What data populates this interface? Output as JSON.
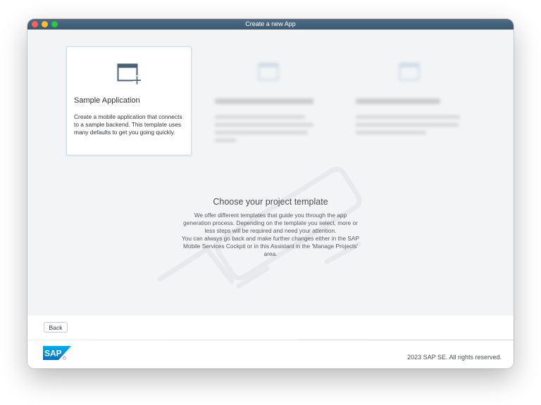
{
  "window": {
    "title": "Create a new App"
  },
  "templates": [
    {
      "title": "Sample Application",
      "description": "Create a mobile application that connects to a sample backend. This template uses many defaults to get you going quickly.",
      "selected": true,
      "icon": "new-window-icon"
    },
    {
      "title": "",
      "description": "",
      "selected": false,
      "icon": "new-window-icon"
    },
    {
      "title": "",
      "description": "",
      "selected": false,
      "icon": "new-window-icon"
    }
  ],
  "info": {
    "title": "Choose your project template",
    "text_lines": [
      "We offer different templates that guide you through the app",
      "generation process. Depending on the template you select, more or",
      "less steps will be required and need your attention.",
      "You can always go back and make further changes either in the SAP",
      "Mobile Services Cockpit or in this Assistant in the 'Manage Projects'",
      "area."
    ]
  },
  "toolbar": {
    "back_label": "Back"
  },
  "footer": {
    "logo": "sap-logo",
    "copyright": "2023 SAP SE. All rights reserved."
  },
  "colors": {
    "titlebar": "#435f7a",
    "accent": "#427cac",
    "card_icon": "#48627a",
    "background": "#f3f4f5"
  }
}
